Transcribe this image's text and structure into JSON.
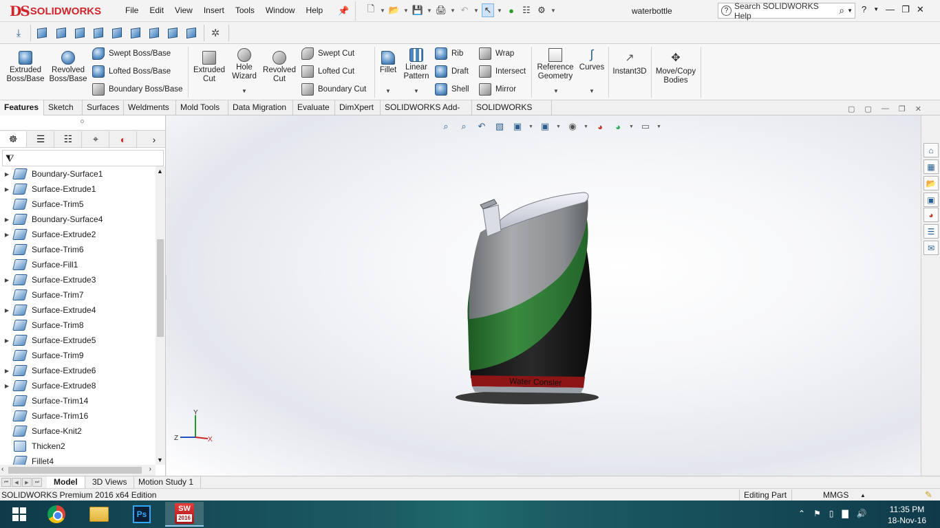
{
  "app": {
    "brand_ds": "DS",
    "brand_name": "SOLIDWORKS",
    "document_title": "waterbottle",
    "menu": [
      "File",
      "Edit",
      "View",
      "Insert",
      "Tools",
      "Window",
      "Help"
    ],
    "search_placeholder": "Search SOLIDWORKS Help",
    "help_label": "?"
  },
  "command_manager": {
    "extruded_boss": "Extruded\nBoss/Base",
    "revolved_boss": "Revolved\nBoss/Base",
    "swept_boss": "Swept Boss/Base",
    "lofted_boss": "Lofted Boss/Base",
    "boundary_boss": "Boundary Boss/Base",
    "extruded_cut": "Extruded\nCut",
    "hole_wizard": "Hole\nWizard",
    "revolved_cut": "Revolved\nCut",
    "swept_cut": "Swept Cut",
    "lofted_cut": "Lofted Cut",
    "boundary_cut": "Boundary Cut",
    "fillet": "Fillet",
    "linear_pattern": "Linear\nPattern",
    "rib": "Rib",
    "draft": "Draft",
    "shell": "Shell",
    "wrap": "Wrap",
    "intersect": "Intersect",
    "mirror": "Mirror",
    "reference_geometry": "Reference\nGeometry",
    "curves": "Curves",
    "instant3d": "Instant3D",
    "move_copy_bodies": "Move/Copy\nBodies"
  },
  "tabs": [
    "Features",
    "Sketch",
    "Surfaces",
    "Weldments",
    "Mold Tools",
    "Data Migration",
    "Evaluate",
    "DimXpert",
    "SOLIDWORKS Add-Ins",
    "SOLIDWORKS MBD"
  ],
  "active_tab": "Features",
  "feature_tree": [
    {
      "label": "Boundary-Surface1",
      "expandable": true
    },
    {
      "label": "Surface-Extrude1",
      "expandable": true
    },
    {
      "label": "Surface-Trim5",
      "expandable": false
    },
    {
      "label": "Boundary-Surface4",
      "expandable": true
    },
    {
      "label": "Surface-Extrude2",
      "expandable": true
    },
    {
      "label": "Surface-Trim6",
      "expandable": false
    },
    {
      "label": "Surface-Fill1",
      "expandable": false
    },
    {
      "label": "Surface-Extrude3",
      "expandable": true
    },
    {
      "label": "Surface-Trim7",
      "expandable": false
    },
    {
      "label": "Surface-Extrude4",
      "expandable": true
    },
    {
      "label": "Surface-Trim8",
      "expandable": false
    },
    {
      "label": "Surface-Extrude5",
      "expandable": true
    },
    {
      "label": "Surface-Trim9",
      "expandable": false
    },
    {
      "label": "Surface-Extrude6",
      "expandable": true
    },
    {
      "label": "Surface-Extrude8",
      "expandable": true
    },
    {
      "label": "Surface-Trim14",
      "expandable": false
    },
    {
      "label": "Surface-Trim16",
      "expandable": false
    },
    {
      "label": "Surface-Knit2",
      "expandable": false
    },
    {
      "label": "Thicken2",
      "expandable": false
    },
    {
      "label": "Fillet4",
      "expandable": false
    }
  ],
  "model": {
    "label_text": "Water Consler",
    "triad": {
      "x": "X",
      "y": "Y",
      "z": "Z"
    }
  },
  "model_tabs": [
    "Model",
    "3D Views",
    "Motion Study 1"
  ],
  "status": {
    "edition": "SOLIDWORKS Premium 2016 x64 Edition",
    "mode": "Editing Part",
    "units": "MMGS"
  },
  "taskbar": {
    "time": "11:35 PM",
    "date": "18-Nov-16",
    "ps_label": "Ps",
    "sw_label": "SW",
    "sw_year": "2016"
  },
  "colors": {
    "brand_red": "#d3242b",
    "bottle_green": "#2f7a35",
    "bottle_grey": "#8f9294",
    "bottle_black": "#1c1c1c",
    "band_red": "#8e1515"
  }
}
